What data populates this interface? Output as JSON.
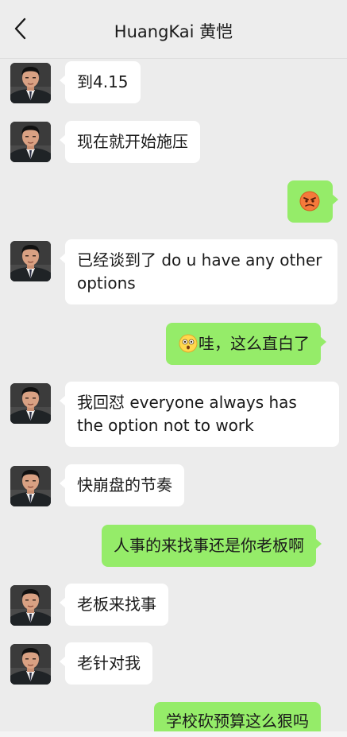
{
  "header": {
    "title": "HuangKai 黄恺"
  },
  "icons": {
    "back": "chevron-left-icon",
    "avatar": "avatar-man-suit",
    "angry": "angry-face-emoji",
    "surprised": "surprised-face-emoji"
  },
  "colors": {
    "incoming_bubble": "#ffffff",
    "outgoing_bubble": "#95ec69",
    "background": "#ececec"
  },
  "messages": [
    {
      "from": "them",
      "text": "到4.15"
    },
    {
      "from": "them",
      "text": "现在就开始施压"
    },
    {
      "from": "me",
      "emoji": "angry-face"
    },
    {
      "from": "them",
      "text": "已经谈到了 do u have any other options"
    },
    {
      "from": "me",
      "emoji": "surprised-face",
      "text": "哇，这么直白了"
    },
    {
      "from": "them",
      "text": "我回怼 everyone always has the option not to work"
    },
    {
      "from": "them",
      "text": "快崩盘的节奏"
    },
    {
      "from": "me",
      "text": "人事的来找事还是你老板啊"
    },
    {
      "from": "them",
      "text": "老板来找事"
    },
    {
      "from": "them",
      "text": "老针对我"
    },
    {
      "from": "me",
      "text": "学校砍预算这么狠吗"
    }
  ]
}
